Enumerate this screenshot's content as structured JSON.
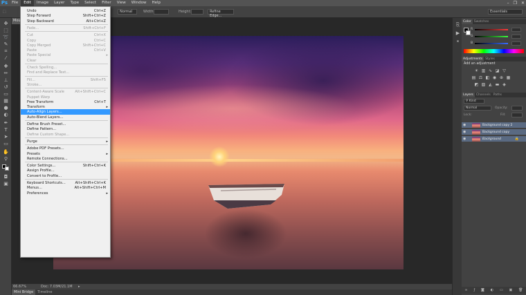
{
  "app": {
    "logo": "Ps"
  },
  "menubar": {
    "items": [
      "File",
      "Edit",
      "Image",
      "Layer",
      "Type",
      "Select",
      "Filter",
      "View",
      "Window",
      "Help"
    ],
    "active": "Edit"
  },
  "window_controls": {
    "minimize": "–",
    "restore": "❐",
    "close": "✕"
  },
  "options_bar": {
    "blend_mode": "Normal",
    "width_label": "Width:",
    "height_label": "Height:",
    "refine_edge": "Refine Edge...",
    "workspace": "Essentials"
  },
  "document_tab": {
    "label": "Mou"
  },
  "status": {
    "zoom": "66.67%",
    "doc": "Doc: 7.03M/21.1M"
  },
  "bottom_tabs": [
    "Mini Bridge",
    "Timeline"
  ],
  "edit_menu": {
    "items": [
      {
        "label": "Undo",
        "shortcut": "Ctrl+Z",
        "disabled": false
      },
      {
        "label": "Step Forward",
        "shortcut": "Shift+Ctrl+Z",
        "disabled": false
      },
      {
        "label": "Step Backward",
        "shortcut": "Alt+Ctrl+Z",
        "disabled": false
      },
      {
        "sep": true
      },
      {
        "label": "Fade...",
        "shortcut": "Shift+Ctrl+F",
        "disabled": true
      },
      {
        "sep": true
      },
      {
        "label": "Cut",
        "shortcut": "Ctrl+X",
        "disabled": true
      },
      {
        "label": "Copy",
        "shortcut": "Ctrl+C",
        "disabled": true
      },
      {
        "label": "Copy Merged",
        "shortcut": "Shift+Ctrl+C",
        "disabled": true
      },
      {
        "label": "Paste",
        "shortcut": "Ctrl+V",
        "disabled": true
      },
      {
        "label": "Paste Special",
        "submenu": true,
        "disabled": true
      },
      {
        "label": "Clear",
        "disabled": true
      },
      {
        "sep": true
      },
      {
        "label": "Check Spelling...",
        "disabled": true
      },
      {
        "label": "Find and Replace Text...",
        "disabled": true
      },
      {
        "sep": true
      },
      {
        "label": "Fill...",
        "shortcut": "Shift+F5",
        "disabled": true
      },
      {
        "label": "Stroke...",
        "disabled": true
      },
      {
        "sep": true
      },
      {
        "label": "Content-Aware Scale",
        "shortcut": "Alt+Shift+Ctrl+C",
        "disabled": true
      },
      {
        "label": "Puppet Warp",
        "disabled": true
      },
      {
        "label": "Free Transform",
        "shortcut": "Ctrl+T",
        "disabled": false
      },
      {
        "label": "Transform",
        "submenu": true,
        "disabled": false
      },
      {
        "label": "Auto-Align Layers...",
        "disabled": false,
        "highlight": true
      },
      {
        "label": "Auto-Blend Layers...",
        "disabled": false
      },
      {
        "sep": true
      },
      {
        "label": "Define Brush Preset...",
        "disabled": false
      },
      {
        "label": "Define Pattern...",
        "disabled": false
      },
      {
        "label": "Define Custom Shape...",
        "disabled": true
      },
      {
        "sep": true
      },
      {
        "label": "Purge",
        "submenu": true,
        "disabled": false
      },
      {
        "sep": true
      },
      {
        "label": "Adobe PDF Presets...",
        "disabled": false
      },
      {
        "label": "Presets",
        "submenu": true,
        "disabled": false
      },
      {
        "label": "Remote Connections...",
        "disabled": false
      },
      {
        "sep": true
      },
      {
        "label": "Color Settings...",
        "shortcut": "Shift+Ctrl+K",
        "disabled": false
      },
      {
        "label": "Assign Profile...",
        "disabled": false
      },
      {
        "label": "Convert to Profile...",
        "disabled": false
      },
      {
        "sep": true
      },
      {
        "label": "Keyboard Shortcuts...",
        "shortcut": "Alt+Shift+Ctrl+K",
        "disabled": false
      },
      {
        "label": "Menus...",
        "shortcut": "Alt+Shift+Ctrl+M",
        "disabled": false
      },
      {
        "label": "Preferences",
        "submenu": true,
        "disabled": false
      }
    ]
  },
  "color_panel": {
    "tabs": [
      "Color",
      "Swatches"
    ],
    "channels": [
      {
        "label": "R",
        "color": "#ff3b3b"
      },
      {
        "label": "G",
        "color": "#3bff3b"
      },
      {
        "label": "B",
        "color": "#3b6bff"
      }
    ]
  },
  "adjustments_panel": {
    "tabs": [
      "Adjustments",
      "Styles"
    ],
    "title": "Add an adjustment"
  },
  "layers_panel": {
    "tabs": [
      "Layers",
      "Channels",
      "Paths"
    ],
    "filter": "Kind",
    "blend": "Normal",
    "opacity_label": "Opacity:",
    "lock_label": "Lock:",
    "fill_label": "Fill:",
    "layers": [
      {
        "name": "Background copy 2"
      },
      {
        "name": "Background copy"
      },
      {
        "name": "Background",
        "locked": true
      }
    ]
  },
  "colors": {
    "menu_highlight": "#3399ff",
    "ps_blue": "#31a8ff",
    "layer_selected": "#5a6a82"
  }
}
